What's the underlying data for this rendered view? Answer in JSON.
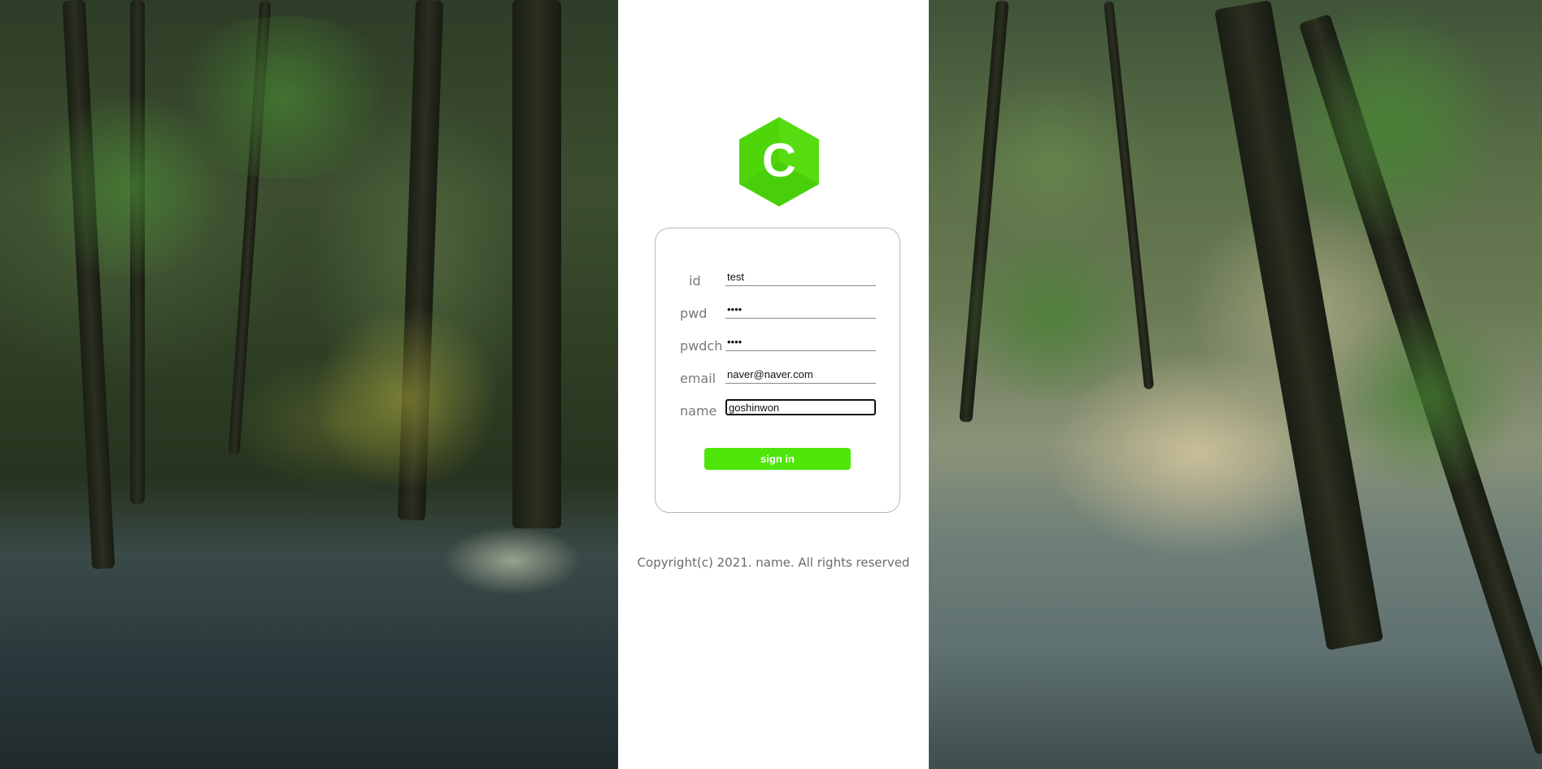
{
  "logo": {
    "letter": "C",
    "color": "#4fd60b"
  },
  "form": {
    "fields": [
      {
        "label": "id",
        "value": "test",
        "type": "text"
      },
      {
        "label": "pwd",
        "value": "••••",
        "type": "password"
      },
      {
        "label": "pwdch",
        "value": "••••",
        "type": "password"
      },
      {
        "label": "email",
        "value": "naver@naver.com",
        "type": "text"
      },
      {
        "label": "name",
        "value": "goshinwon",
        "type": "text"
      }
    ],
    "submit_label": "sign in",
    "accent": "#4ee60a"
  },
  "footer": {
    "copyright": "Copyright(c) 2021. name. All rights reserved"
  }
}
